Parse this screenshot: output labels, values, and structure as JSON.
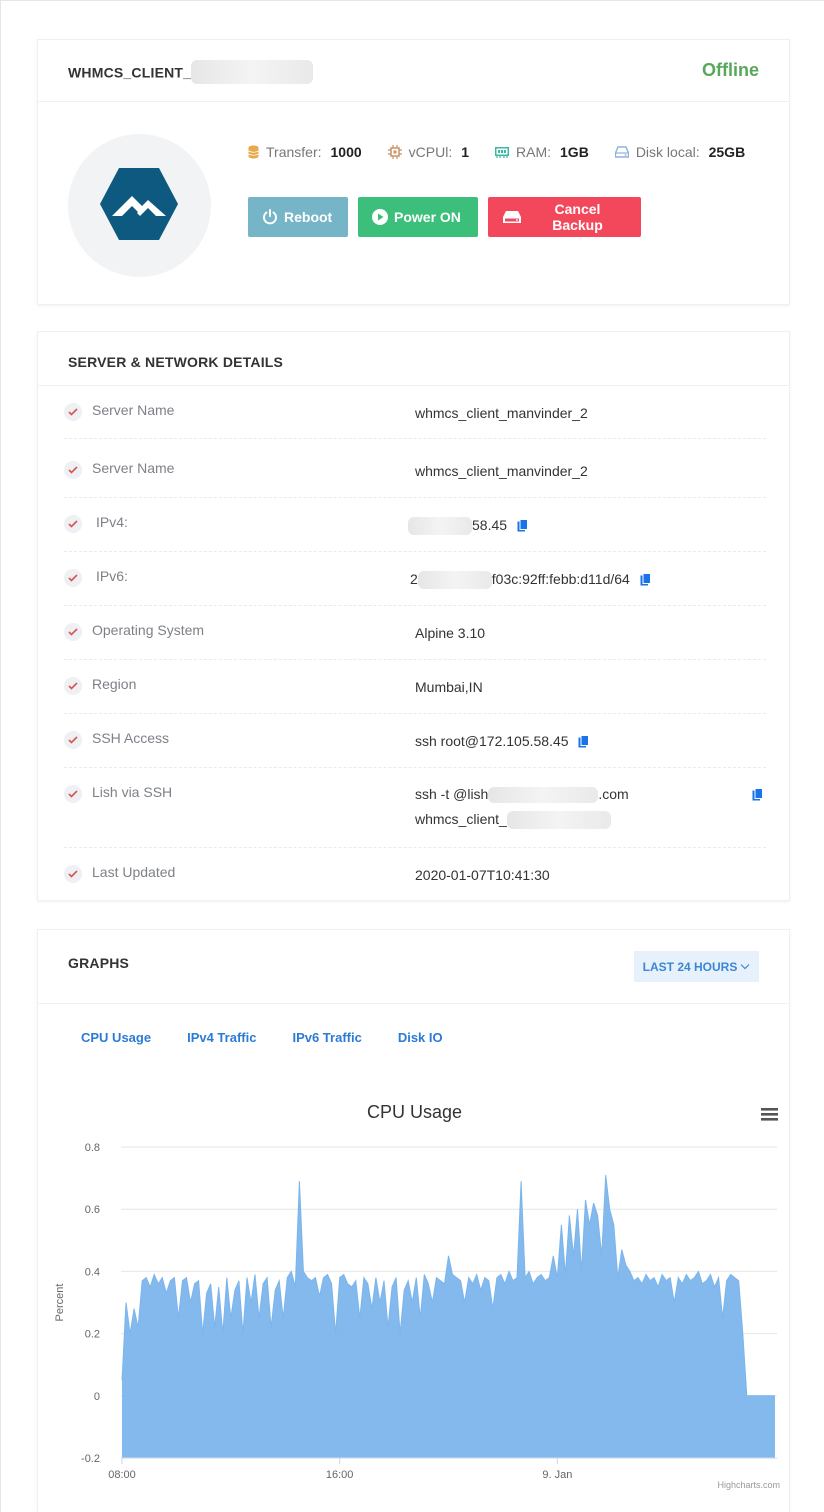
{
  "server": {
    "title": "WHMCS_CLIENT_",
    "status": "Offline",
    "specs": [
      {
        "icon": "database-icon",
        "label": "Transfer:",
        "value": "1000",
        "color": "#e8a94a"
      },
      {
        "icon": "cpu-icon",
        "label": "vCPUl:",
        "value": "1",
        "color": "#c8926a"
      },
      {
        "icon": "ram-icon",
        "label": "RAM:",
        "value": "1GB",
        "color": "#3cb9a4"
      },
      {
        "icon": "disk-icon",
        "label": "Disk local:",
        "value": "25GB",
        "color": "#8fb2d8"
      }
    ],
    "buttons": {
      "reboot": "Reboot",
      "power_on": "Power ON",
      "cancel_backup": "Cancel Backup"
    }
  },
  "details": {
    "title": "SERVER & NETWORK DETAILS",
    "rows": [
      {
        "key": "Server Name",
        "value": "whmcs_client_manvinder_2"
      },
      {
        "key": "Server Name",
        "value": "whmcs_client_manvinder_2"
      },
      {
        "key": "IPv4:",
        "value": "58.45"
      },
      {
        "key": "IPv6:",
        "value_prefix": "2",
        "value": "f03c:92ff:febb:d11d/64"
      },
      {
        "key": "Operating System",
        "value": "Alpine 3.10"
      },
      {
        "key": "Region",
        "value": "Mumbai,IN"
      },
      {
        "key": "SSH Access",
        "value": "ssh root@172.105.58.45"
      },
      {
        "key": "Lish via SSH",
        "value": "ssh -t @lish",
        "value_suffix": ".com",
        "value_line2": "whmcs_client_"
      },
      {
        "key": "Last Updated",
        "value": "2020-01-07T10:41:30"
      }
    ]
  },
  "graphs": {
    "title": "GRAPHS",
    "range": "LAST 24 HOURS",
    "tabs": [
      "CPU Usage",
      "IPv4 Traffic",
      "IPv6 Traffic",
      "Disk IO"
    ],
    "credits": "Highcharts.com"
  },
  "chart_data": {
    "type": "area",
    "title": "CPU Usage",
    "ylabel": "Percent",
    "xlabel": "",
    "ylim": [
      -0.2,
      0.8
    ],
    "yticks": [
      "0.8",
      "0.6",
      "0.4",
      "0.2",
      "0",
      "-0.2"
    ],
    "xticks": [
      {
        "label": "08:00",
        "hour": 8
      },
      {
        "label": "16:00",
        "hour": 16
      },
      {
        "label": "9. Jan",
        "hour": 24
      }
    ],
    "x_start_hour": 8,
    "x_end_hour": 32,
    "color": "#7cb5ec",
    "values": [
      0.05,
      0.3,
      0.2,
      0.28,
      0.22,
      0.37,
      0.38,
      0.35,
      0.39,
      0.36,
      0.38,
      0.33,
      0.37,
      0.38,
      0.25,
      0.37,
      0.38,
      0.3,
      0.36,
      0.37,
      0.2,
      0.33,
      0.36,
      0.22,
      0.35,
      0.2,
      0.38,
      0.25,
      0.34,
      0.37,
      0.2,
      0.38,
      0.3,
      0.39,
      0.25,
      0.36,
      0.38,
      0.22,
      0.34,
      0.37,
      0.25,
      0.38,
      0.4,
      0.35,
      0.69,
      0.4,
      0.38,
      0.37,
      0.38,
      0.32,
      0.38,
      0.39,
      0.36,
      0.2,
      0.38,
      0.39,
      0.36,
      0.35,
      0.37,
      0.25,
      0.38,
      0.36,
      0.28,
      0.38,
      0.3,
      0.37,
      0.22,
      0.35,
      0.38,
      0.2,
      0.34,
      0.37,
      0.3,
      0.38,
      0.25,
      0.39,
      0.36,
      0.3,
      0.38,
      0.37,
      0.36,
      0.45,
      0.39,
      0.38,
      0.37,
      0.3,
      0.38,
      0.36,
      0.39,
      0.34,
      0.38,
      0.37,
      0.28,
      0.38,
      0.39,
      0.36,
      0.4,
      0.37,
      0.38,
      0.69,
      0.38,
      0.4,
      0.36,
      0.38,
      0.39,
      0.37,
      0.38,
      0.45,
      0.38,
      0.55,
      0.39,
      0.58,
      0.45,
      0.6,
      0.4,
      0.63,
      0.55,
      0.62,
      0.58,
      0.45,
      0.71,
      0.6,
      0.55,
      0.38,
      0.47,
      0.42,
      0.4,
      0.37,
      0.38,
      0.36,
      0.39,
      0.37,
      0.38,
      0.35,
      0.39,
      0.37,
      0.38,
      0.3,
      0.38,
      0.36,
      0.39,
      0.37,
      0.38,
      0.4,
      0.36,
      0.37,
      0.39,
      0.35,
      0.38,
      0.25,
      0.37,
      0.39,
      0.38,
      0.37,
      0.2,
      0.0,
      0.0,
      0.0,
      0.0,
      0.0,
      0.0,
      0.0,
      0.0
    ]
  }
}
